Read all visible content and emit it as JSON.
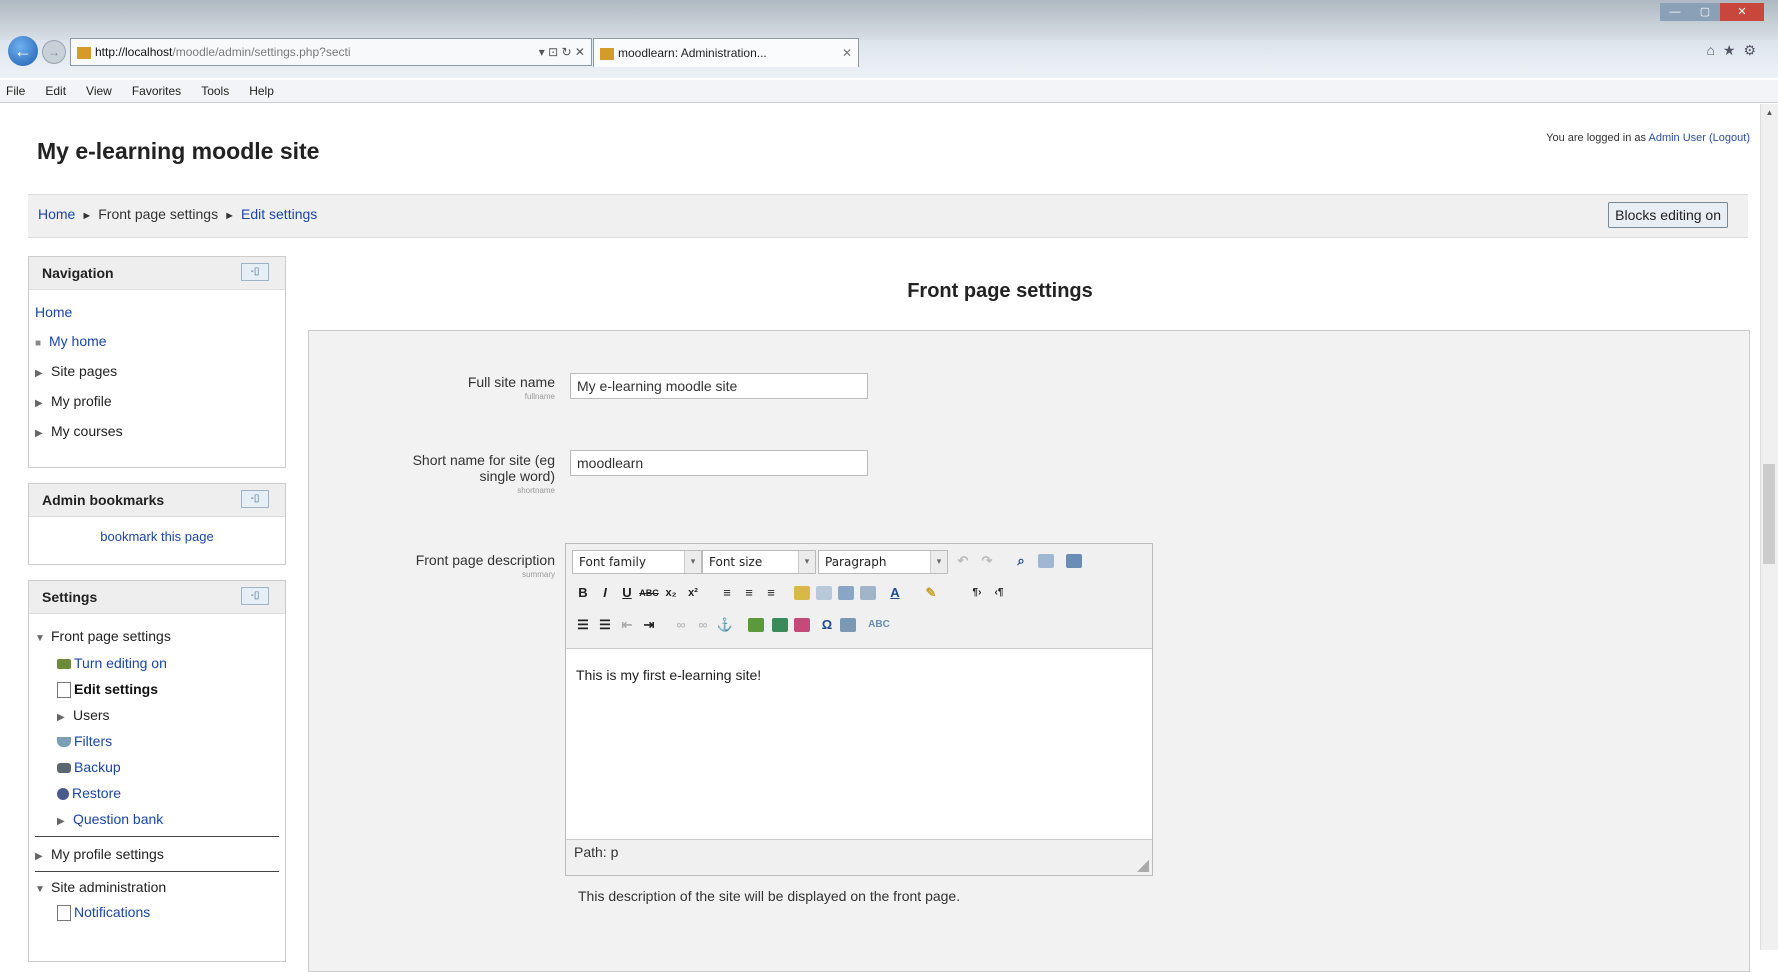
{
  "browser": {
    "url_host": "http://localhost",
    "url_path": "/moodle/admin/settings.php?secti",
    "url_controls": "▾ ⊡ ↻ ✕",
    "tab_title": "moodlearn: Administration...",
    "tab_close": "✕",
    "menu": [
      "File",
      "Edit",
      "View",
      "Favorites",
      "Tools",
      "Help"
    ]
  },
  "header": {
    "site_title": "My e-learning moodle site",
    "login_prefix": "You are logged in as",
    "user_name": "Admin User",
    "logout": "(Logout)"
  },
  "breadcrumb": {
    "home": "Home",
    "middle": "Front page settings",
    "current": "Edit settings",
    "separator": "►"
  },
  "blocks_button": "Blocks editing on",
  "navigation": {
    "title": "Navigation",
    "home": "Home",
    "items": [
      "My home",
      "Site pages",
      "My profile",
      "My courses"
    ]
  },
  "admin_bookmarks": {
    "title": "Admin bookmarks",
    "link": "bookmark this page"
  },
  "settings_block": {
    "title": "Settings",
    "front_page_settings": "Front page settings",
    "items": [
      "Turn editing on",
      "Edit settings",
      "Users",
      "Filters",
      "Backup",
      "Restore",
      "Question bank"
    ],
    "my_profile_settings": "My profile settings",
    "site_administration": "Site administration",
    "notifications": "Notifications"
  },
  "main": {
    "title": "Front page settings",
    "fields": {
      "fullname_label": "Full site name",
      "fullname_key": "fullname",
      "fullname_value": "My e-learning moodle site",
      "shortname_label_1": "Short name for site (eg",
      "shortname_label_2": "single word)",
      "shortname_key": "shortname",
      "shortname_value": "moodlearn",
      "description_label": "Front page description",
      "description_key": "summary"
    },
    "editor": {
      "font_family": "Font family",
      "font_size": "Font size",
      "format": "Paragraph",
      "content": "This is my first e-learning site!",
      "path": "Path: p"
    },
    "help_text": "This description of the site will be displayed on the front page."
  },
  "colors": {
    "link": "#1a46a8",
    "panel_bg": "#f2f2f2",
    "block_head_bg": "#eeeeee"
  }
}
